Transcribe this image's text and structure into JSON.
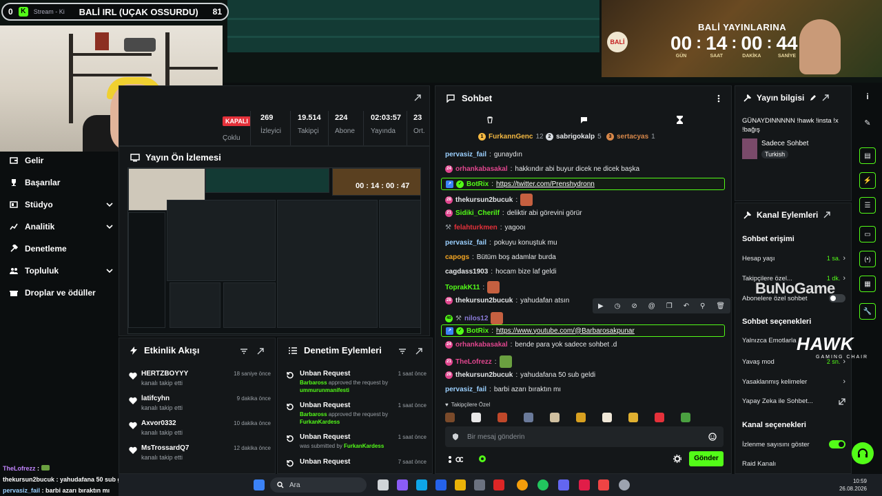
{
  "stream_bar": {
    "left_count": "0",
    "source_label": "Stream - Ki",
    "title": "BALİ IRL (UÇAK OSSURDU)",
    "right_count": "81"
  },
  "countdown": {
    "title": "BALİ YAYINLARINA",
    "cells": [
      {
        "value": "00",
        "label": "GÜN"
      },
      {
        "value": "14",
        "label": "SAAT"
      },
      {
        "value": "00",
        "label": "DAKİKA"
      },
      {
        "value": "44",
        "label": "SANİYE"
      }
    ]
  },
  "nav": {
    "items": [
      {
        "label": "Gelir",
        "icon": "wallet-icon"
      },
      {
        "label": "Başarılar",
        "icon": "trophy-icon"
      },
      {
        "label": "Stüdyo",
        "icon": "studio-icon",
        "expandable": true
      },
      {
        "label": "Analitik",
        "icon": "chart-icon",
        "expandable": true
      },
      {
        "label": "Denetleme",
        "icon": "hammer-icon"
      },
      {
        "label": "Topluluk",
        "icon": "community-icon",
        "expandable": true
      },
      {
        "label": "Droplar ve ödüller",
        "icon": "gift-icon"
      }
    ]
  },
  "stats": {
    "status": "KAPALI",
    "status_sub": "Çoklu",
    "items": [
      {
        "value": "269",
        "label": "İzleyici"
      },
      {
        "value": "19.514",
        "label": "Takipçi"
      },
      {
        "value": "224",
        "label": "Abone"
      },
      {
        "value": "02:03:57",
        "label": "Yayında"
      },
      {
        "value": "23",
        "label": "Ort."
      }
    ]
  },
  "preview": {
    "title": "Yayın Ön İzlemesi"
  },
  "activity": {
    "title": "Etkinlik Akışı",
    "items": [
      {
        "name": "HERTZBOYYY",
        "action": "kanalı takip etti",
        "time": "18 saniye önce"
      },
      {
        "name": "latifcyhn",
        "action": "kanalı takip etti",
        "time": "9 dakika önce"
      },
      {
        "name": "Axvor0332",
        "action": "kanalı takip etti",
        "time": "10 dakika önce"
      },
      {
        "name": "MsTrossardQ7",
        "action": "kanalı takip etti",
        "time": "12 dakika önce"
      }
    ]
  },
  "moderation": {
    "title": "Denetim Eylemleri",
    "items": [
      {
        "title": "Unban Request",
        "line1_user": "Barbaross",
        "line1": " approved the request by",
        "line2_user": "ummurunmanifesti",
        "time": "1 saat önce"
      },
      {
        "title": "Unban Request",
        "line1_user": "Barbaross",
        "line1": " approved the request by",
        "line2_user": "FurkanKardess",
        "time": "1 saat önce"
      },
      {
        "title": "Unban Request",
        "line1_user": "",
        "line1": "was submitted by ",
        "line2_user": "FurkanKardess",
        "time": "1 saat önce"
      },
      {
        "title": "Unban Request",
        "line1_user": "",
        "line1": "",
        "line2_user": "",
        "time": "7 saat önce"
      }
    ]
  },
  "chat": {
    "title": "Sohbet",
    "gifters": [
      {
        "rank": "1",
        "name": "FurkannGenc",
        "count": "12",
        "color": "#f5b942"
      },
      {
        "rank": "2",
        "name": "sabrigokalp",
        "count": "5",
        "color": "#d8dde2"
      },
      {
        "rank": "3",
        "name": "sertacyas",
        "count": "1",
        "color": "#d9884a"
      }
    ],
    "messages": [
      {
        "user": "pervasiz_fail",
        "text": "gunaydın",
        "color": "#9bd0ff"
      },
      {
        "user": "orhankabasakal",
        "text": "hakkındır abi buyur dicek ne dicek başka",
        "color": "#e0468e"
      },
      {
        "user": "BotRix",
        "text": "https://twitter.com/Prenshydronn",
        "color": "#53fc18",
        "bot": true
      },
      {
        "user": "thekursun2bucuk",
        "text": "",
        "color": "#ffffff",
        "emote": true
      },
      {
        "user": "Sidiki_Cherilf",
        "text": "deliktir abi görevini görür",
        "color": "#53fc18"
      },
      {
        "user": "felahturkmen",
        "text": "yagooı",
        "color": "#e5313a"
      },
      {
        "user": "pervasiz_fail",
        "text": "pokuyu konuştuk mu",
        "color": "#9bd0ff"
      },
      {
        "user": "capogs",
        "text": "Bütüm boş adamlar burda",
        "color": "#f5a623"
      },
      {
        "user": "cagdass1903",
        "text": "hocam bize laf geldi",
        "color": "#ffffff"
      },
      {
        "user": "ToprakK11",
        "text": "",
        "color": "#53fc18",
        "emote": true
      },
      {
        "user": "thekursun2bucuk",
        "text": "yahudafan atsın",
        "color": "#ffffff"
      },
      {
        "user": "nilos12",
        "text": "",
        "color": "#8a7bd8",
        "emote": true
      },
      {
        "user": "BotRix",
        "text": "https://www.youtube.com/@Barbarosakpunar",
        "color": "#53fc18",
        "bot": true
      },
      {
        "user": "orhankabasakal",
        "text": "bende para yok sadece sohbet .d",
        "color": "#e0468e"
      },
      {
        "user": "TheLofrezz",
        "text": "",
        "color": "#e0468e",
        "emote": true
      },
      {
        "user": "thekursun2bucuk",
        "text": "yahudafana 50 sub geldi",
        "color": "#ffffff"
      },
      {
        "user": "pervasiz_fail",
        "text": "barbi azarı bıraktın mı",
        "color": "#9bd0ff"
      }
    ],
    "follower_label": "Takipçilere Özel",
    "input_placeholder": "Bir mesaj gönderin",
    "send_label": "Gönder"
  },
  "stream_info": {
    "title": "Yayın bilgisi",
    "description": "GÜNAYDINNNNN !hawk !insta !x !bağış",
    "category": "Sadece Sohbet",
    "language": "Turkish"
  },
  "channel_actions": {
    "title": "Kanal Eylemleri",
    "chat_access": "Sohbet erişimi",
    "account_age": {
      "label": "Hesap yaşı",
      "value": "1 sa."
    },
    "follower_only": {
      "label": "Takipçilere özel...",
      "value": "1 dk."
    },
    "sub_only": {
      "label": "Abonelere özel sohbet"
    },
    "chat_options": "Sohbet seçenekleri",
    "emotes_only": {
      "label": "Yalnızca Emotlarla"
    },
    "slow_mode": {
      "label": "Yavaş mod",
      "value": "2 sn."
    },
    "banned_words": {
      "label": "Yasaklanmış kelimeler"
    },
    "ai_chat": {
      "label": "Yapay Zeka ile Sohbet..."
    },
    "channel_options": "Kanal seçenekleri",
    "view_count": {
      "label": "İzlenme sayısını göster"
    },
    "raid": {
      "label": "Raid Kanalı"
    }
  },
  "overlay_chat": [
    {
      "user": "TheLofrezz",
      "text": ":"
    },
    {
      "user": "thekursun2bucuk",
      "text": ": yahudafana 50 sub geldi"
    },
    {
      "user": "pervasiz_fail",
      "text": ": barbi azarı bıraktın mı"
    }
  ],
  "watermarks": {
    "bunogame": "BuNoGame",
    "hawk": "HAWK",
    "hawk_sub": "GAMING CHAIR"
  },
  "taskbar": {
    "search": "Ara",
    "time": "10:59",
    "date": "26.08.2026"
  },
  "colors": {
    "accent": "#53fc18",
    "panel": "#141719",
    "danger": "#e5313a"
  }
}
